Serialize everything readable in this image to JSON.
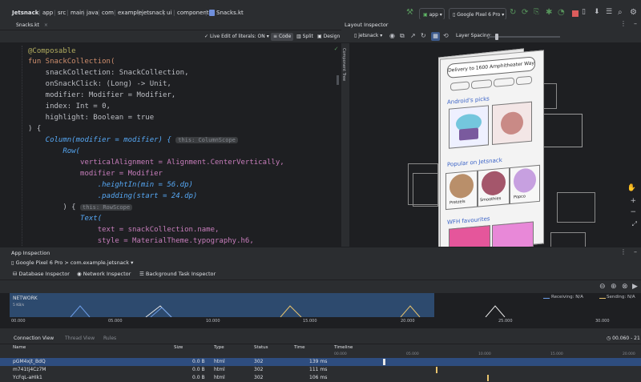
{
  "breadcrumbs": [
    "Jetsnack",
    "app",
    "src",
    "main",
    "java",
    "com",
    "example",
    "jetsnack",
    "ui",
    "components",
    "Snacks.kt"
  ],
  "toolbar": {
    "run_config": "app",
    "device": "Google Pixel 6 Pro"
  },
  "editor": {
    "file_tab": "Snacks.kt",
    "live_edit": "Live Edit of literals: ON",
    "mode_code": "Code",
    "mode_split": "Split",
    "mode_design": "Design",
    "code_lines": [
      "@Composable",
      "fun SnackCollection(",
      "    snackCollection: SnackCollection,",
      "    onSnackClick: (Long) -> Unit,",
      "    modifier: Modifier = Modifier,",
      "    index: Int = 0,",
      "    highlight: Boolean = true",
      ") {",
      "    Column(modifier = modifier) {",
      "        Row(",
      "            verticalAlignment = Alignment.CenterVertically,",
      "            modifier = Modifier",
      "                .heightIn(min = 56.dp)",
      "                .padding(start = 24.dp)",
      "        ) {",
      "            Text(",
      "                text = snackCollection.name,",
      "                style = MaterialTheme.typography.h6,"
    ],
    "hint_column_scope": "this: ColumnScope",
    "hint_row_scope": "this: RowScope"
  },
  "layout_inspector": {
    "title": "Layout Inspector",
    "process": "jetsnack",
    "layer_spacing_label": "Layer Spacing:",
    "component_tree_label": "Component Tree",
    "layer_spacing_fraction": 0.1,
    "app_view": {
      "address": "Delivery to 1600 Amphitheater Way",
      "section1": "Android's picks",
      "section2": "Popular on Jetsnack",
      "section3": "WFH favourites",
      "items": [
        "Pretzels",
        "Smoothies",
        "Popco"
      ]
    }
  },
  "app_inspection": {
    "title": "App Inspection",
    "device_process": "Google Pixel 6 Pro > com.example.jetsnack",
    "tabs": [
      "Database Inspector",
      "Network Inspector",
      "Background Task Inspector"
    ],
    "active_tab": "Network Inspector",
    "network": {
      "label": "NETWORK",
      "scale": "5 KB/s",
      "receiving": "Receiving: N/A",
      "sending": "Sending: N/A",
      "axis_ticks": [
        "00.000",
        "05.000",
        "10.000",
        "15.000",
        "20.000",
        "25.000",
        "30.000",
        "35.000",
        "40.000"
      ]
    },
    "conn_tabs": [
      "Connection View",
      "Thread View",
      "Rules"
    ],
    "time_range": "00.060 - 21",
    "columns": [
      "Name",
      "Size",
      "Type",
      "Status",
      "Time",
      "Timeline"
    ],
    "timeline_ticks": [
      "00.000",
      "05.000",
      "10.000",
      "15.000",
      "20.000",
      "25.000",
      "30.000",
      "35.000"
    ],
    "rows": [
      {
        "name": "pGM4xjt_BdQ",
        "size": "0.0 B",
        "type": "html",
        "status": "302",
        "time": "139 ms"
      },
      {
        "name": "m741tj4Cz7M",
        "size": "0.0 B",
        "type": "html",
        "status": "302",
        "time": "111 ms"
      },
      {
        "name": "YcFqL-aHIk1",
        "size": "0.0 B",
        "type": "html",
        "status": "302",
        "time": "106 ms"
      }
    ]
  },
  "colors": {
    "accent": "#3574f0",
    "receiving": "#6d9ee8",
    "sending": "#e8c36d",
    "selected_row": "#2e4d7f"
  }
}
